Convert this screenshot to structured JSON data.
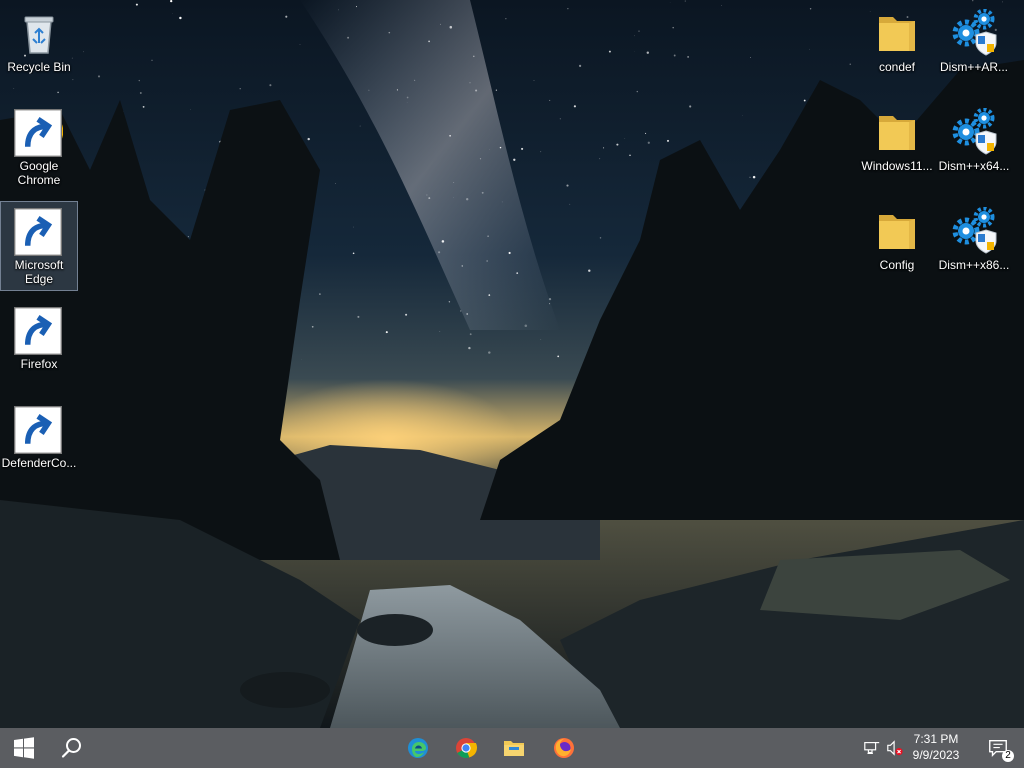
{
  "desktop": {
    "icons_left": [
      {
        "label": "Recycle Bin",
        "icon": "recycle-bin-icon"
      },
      {
        "label": "Google Chrome",
        "icon": "chrome-icon"
      },
      {
        "label": "Microsoft Edge",
        "icon": "edge-icon",
        "selected": true
      },
      {
        "label": "Firefox",
        "icon": "firefox-icon"
      },
      {
        "label": "DefenderCo...",
        "icon": "defender-control-icon"
      }
    ],
    "icons_right": [
      {
        "label": "condef",
        "icon": "folder-icon"
      },
      {
        "label": "Dism++AR...",
        "icon": "dism-gear-icon"
      },
      {
        "label": "Windows11...",
        "icon": "folder-icon"
      },
      {
        "label": "Dism++x64...",
        "icon": "dism-gear-icon"
      },
      {
        "label": "Config",
        "icon": "folder-icon"
      },
      {
        "label": "Dism++x86...",
        "icon": "dism-gear-icon"
      }
    ]
  },
  "taskbar": {
    "start_icon": "windows-logo-icon",
    "search_icon": "search-icon",
    "pinned": [
      "edge-icon",
      "chrome-icon",
      "file-explorer-icon",
      "firefox-icon"
    ],
    "tray": {
      "network_icon": "network-disconnected-icon",
      "volume_icon": "volume-muted-icon",
      "time": "7:31 PM",
      "date": "9/9/2023",
      "notification_count": "2"
    }
  },
  "colors": {
    "taskbar": "#1c1e24",
    "accent": "#0078d7",
    "folder": "#f2c955"
  }
}
